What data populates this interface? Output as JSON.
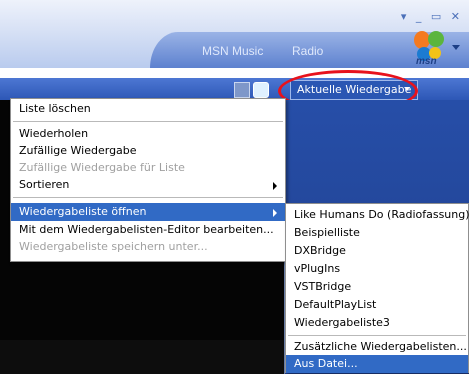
{
  "header": {
    "tabs": [
      "MSN Music",
      "Radio"
    ],
    "window_controls": "▾ _ ▭ ✕",
    "logo_text": "msn"
  },
  "toolbar": {
    "now_playing_label": "Aktuelle Wiedergabe"
  },
  "main_menu": {
    "items": [
      {
        "label": "Liste löschen",
        "enabled": true
      },
      {
        "label": "Wiederholen",
        "enabled": true
      },
      {
        "label": "Zufällige Wiedergabe",
        "enabled": true
      },
      {
        "label": "Zufällige Wiedergabe für Liste",
        "enabled": false
      },
      {
        "label": "Sortieren",
        "enabled": true,
        "submenu": true
      },
      {
        "label": "Wiedergabeliste öffnen",
        "enabled": true,
        "submenu": true,
        "highlighted": true
      },
      {
        "label": "Mit dem Wiedergabelisten-Editor bearbeiten...",
        "enabled": true
      },
      {
        "label": "Wiedergabeliste speichern unter...",
        "enabled": false
      }
    ]
  },
  "sub_menu": {
    "items": [
      {
        "label": "Like Humans Do (Radiofassung)"
      },
      {
        "label": "Beispielliste"
      },
      {
        "label": "DXBridge"
      },
      {
        "label": "vPlugIns"
      },
      {
        "label": "VSTBridge"
      },
      {
        "label": "DefaultPlayList"
      },
      {
        "label": "Wiedergabeliste3"
      },
      {
        "label": "Zusätzliche Wiedergabelisten..."
      },
      {
        "label": "Aus Datei...",
        "highlighted": true
      }
    ]
  },
  "colors": {
    "menu_highlight": "#316ac5",
    "annotation_circle": "#e8121c",
    "toolbar_blue": "#2d57b6"
  }
}
